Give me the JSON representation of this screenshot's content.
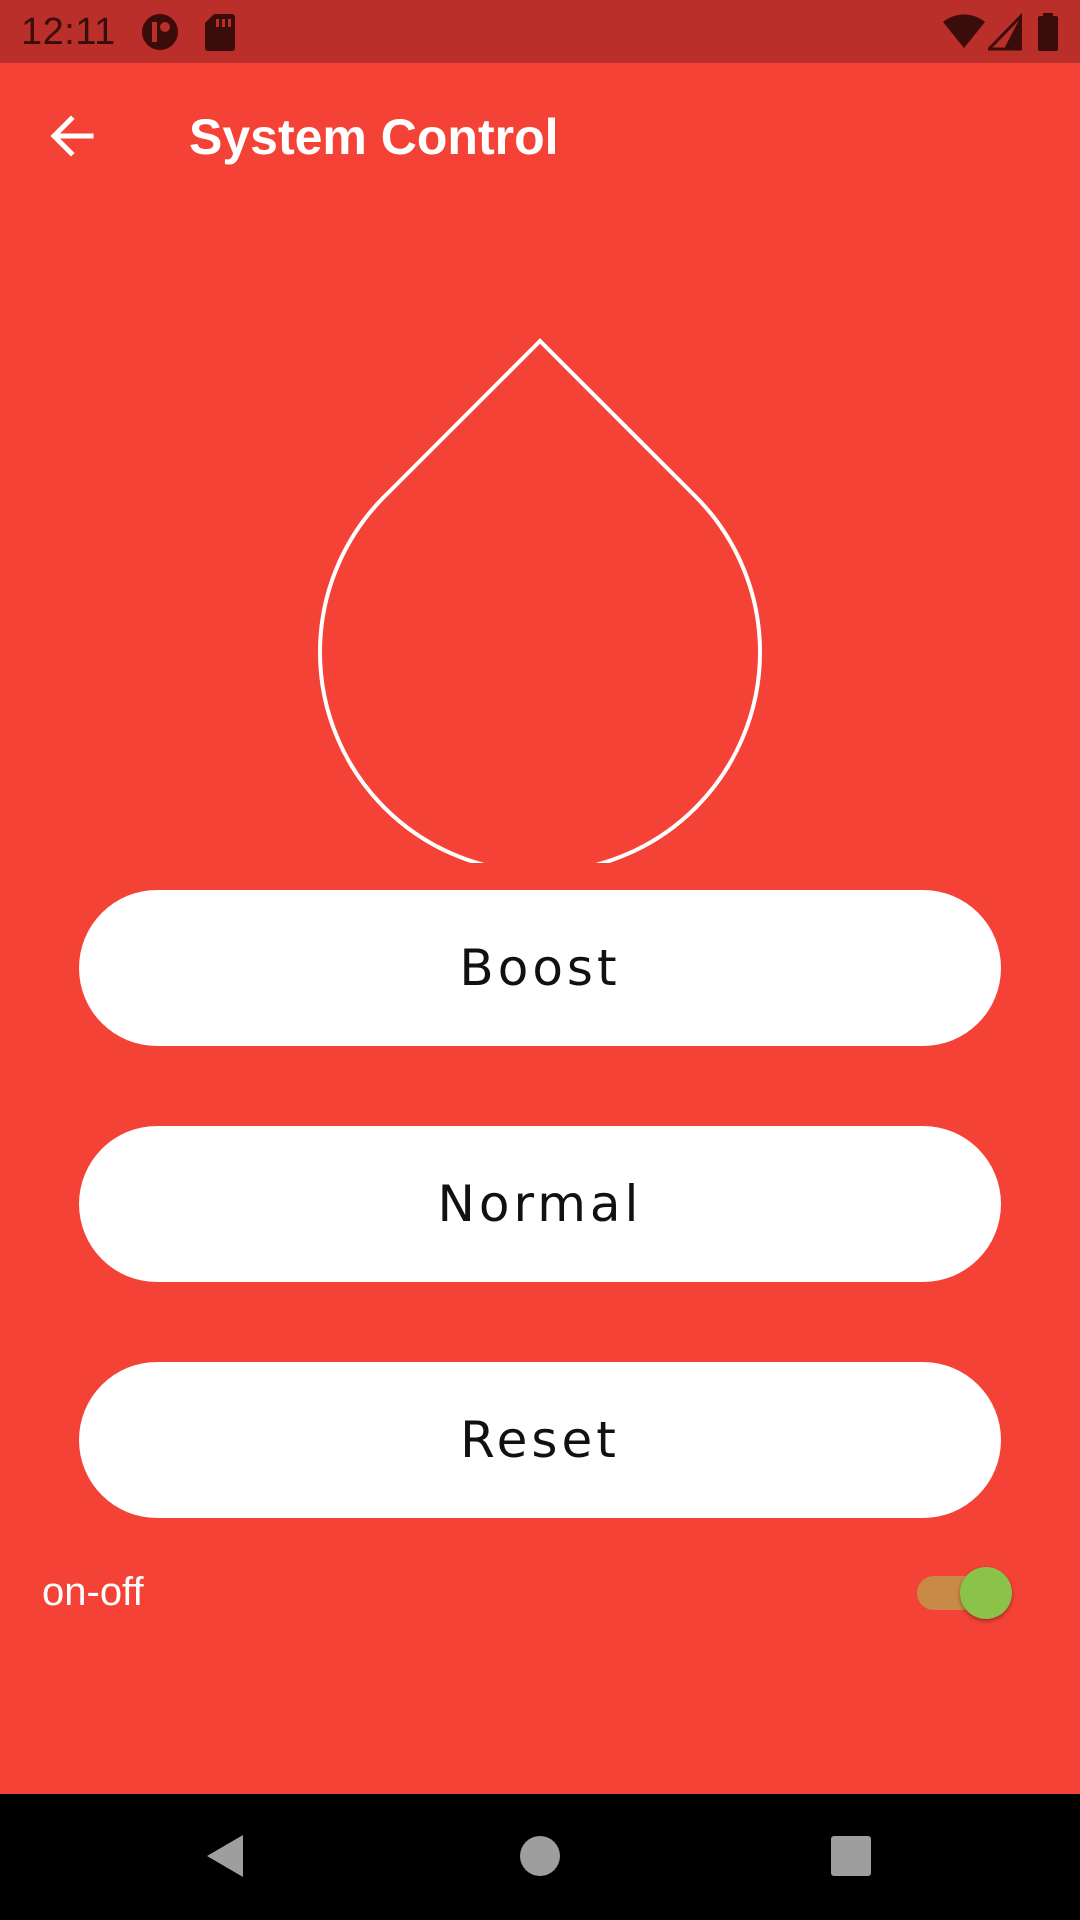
{
  "status_bar": {
    "time": "12:11",
    "icons": [
      "app-notification-icon",
      "sd-card-icon",
      "wifi-icon",
      "cell-signal-icon",
      "battery-icon"
    ]
  },
  "app_bar": {
    "title": "System Control",
    "back_icon": "arrow-back-icon"
  },
  "drop_icon": "water-drop-outline",
  "buttons": {
    "boost": "Boost",
    "normal": "Normal",
    "reset": "Reset"
  },
  "switch": {
    "label": "on-off",
    "checked": true
  },
  "nav_bar": {
    "icons": [
      "nav-back-icon",
      "nav-home-icon",
      "nav-recents-icon"
    ]
  },
  "colors": {
    "background": "#f44336",
    "status_bar": "#ba2f29",
    "button": "#ffffff",
    "switch_thumb": "#8bc34a",
    "switch_track": "#c98a48"
  }
}
